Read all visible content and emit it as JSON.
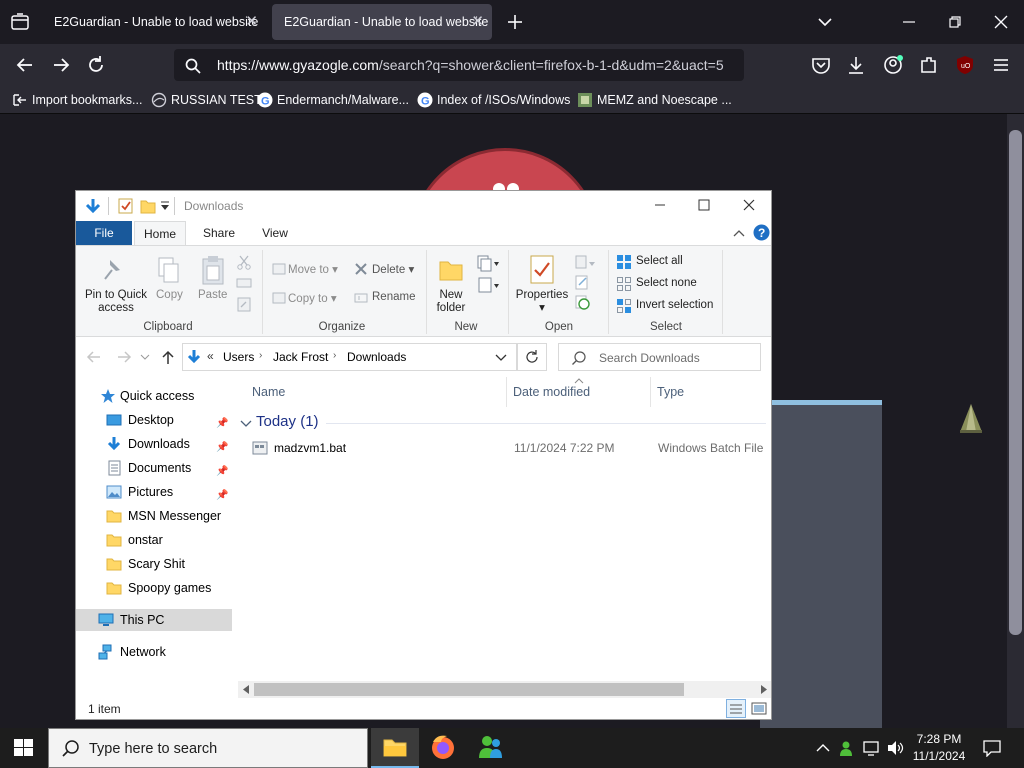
{
  "browser": {
    "tabs": [
      {
        "title": "E2Guardian - Unable to load website",
        "close": "✕"
      },
      {
        "title": "E2Guardian - Unable to load website",
        "close": "✕"
      }
    ],
    "url": {
      "host": "https://www.gyazogle.com",
      "path": "/search?q=shower&client=firefox-b-1-d&udm=2&uact=5"
    },
    "bookmarks": [
      {
        "label": "Import bookmarks...",
        "icon": "import-icon"
      },
      {
        "label": "RUSSIAN TEST",
        "icon": "globe-icon"
      },
      {
        "label": "Endermanch/Malware...",
        "icon": "google-icon"
      },
      {
        "label": "Index of /ISOs/Windows",
        "icon": "google-icon"
      },
      {
        "label": "MEMZ and Noescape ...",
        "icon": "image-icon"
      }
    ]
  },
  "explorer": {
    "title": "Downloads",
    "ribbon_tabs": [
      "File",
      "Home",
      "Share",
      "View"
    ],
    "clipboard": {
      "pin": "Pin to Quick",
      "pin2": "access",
      "copy": "Copy",
      "paste": "Paste",
      "group": "Clipboard"
    },
    "organize": {
      "move_to": "Move to",
      "copy_to": "Copy to",
      "delete": "Delete",
      "rename": "Rename",
      "group": "Organize"
    },
    "new": {
      "new_folder": "New",
      "new_folder2": "folder",
      "group": "New"
    },
    "open": {
      "properties": "Properties",
      "group": "Open"
    },
    "select": {
      "select_all": "Select all",
      "select_none": "Select none",
      "invert": "Invert selection",
      "group": "Select"
    },
    "breadcrumb": {
      "sep": "«",
      "items": [
        "Users",
        "Jack Frost",
        "Downloads"
      ]
    },
    "search_placeholder": "Search Downloads",
    "nav": {
      "quick_access": "Quick access",
      "items": [
        {
          "label": "Desktop",
          "pinned": true
        },
        {
          "label": "Downloads",
          "pinned": true
        },
        {
          "label": "Documents",
          "pinned": true
        },
        {
          "label": "Pictures",
          "pinned": true
        },
        {
          "label": "MSN Messenger"
        },
        {
          "label": "onstar"
        },
        {
          "label": "Scary Shit"
        },
        {
          "label": "Spoopy games"
        }
      ],
      "this_pc": "This PC",
      "network": "Network"
    },
    "columns": [
      "Name",
      "Date modified",
      "Type"
    ],
    "group_header": "Today (1)",
    "files": [
      {
        "name": "madzvm1.bat",
        "date": "11/1/2024 7:22 PM",
        "type": "Windows Batch File"
      }
    ],
    "status": "1 item"
  },
  "taskbar": {
    "search_placeholder": "Type here to search",
    "time": "7:28 PM",
    "date": "11/1/2024"
  }
}
